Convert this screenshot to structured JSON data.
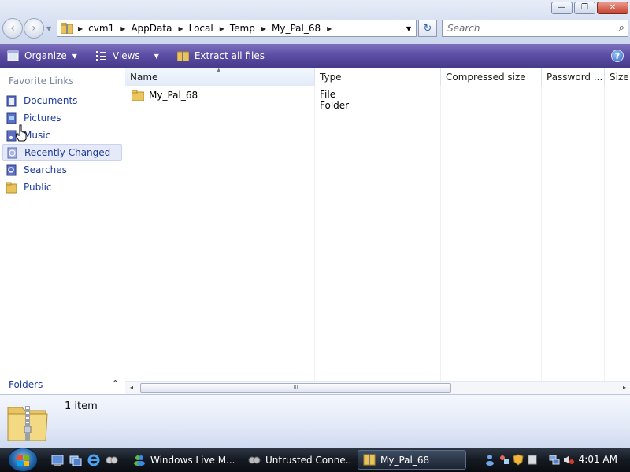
{
  "window": {
    "minimize_glyph": "—",
    "maximize_glyph": "❐",
    "close_glyph": "✕"
  },
  "address": {
    "crumbs": [
      "cvm1",
      "AppData",
      "Local",
      "Temp",
      "My_Pal_68"
    ],
    "back_glyph": "‹",
    "forward_glyph": "›",
    "dropdown_glyph": "▼",
    "refresh_glyph": "↻"
  },
  "search": {
    "placeholder": "Search",
    "icon": "search-icon"
  },
  "toolbar": {
    "organize_label": "Organize",
    "views_label": "Views",
    "extract_label": "Extract all files",
    "help_label": "?",
    "arrow": "▼"
  },
  "nav": {
    "heading": "Favorite Links",
    "items": [
      {
        "label": "Documents",
        "icon": "documents-icon"
      },
      {
        "label": "Pictures",
        "icon": "pictures-icon"
      },
      {
        "label": "Music",
        "icon": "music-icon"
      },
      {
        "label": "Recently Changed",
        "icon": "recently-changed-icon"
      },
      {
        "label": "Searches",
        "icon": "searches-icon"
      },
      {
        "label": "Public",
        "icon": "public-folder-icon"
      }
    ],
    "selected_index": 3,
    "folders_label": "Folders",
    "folders_chevron": "⌃"
  },
  "columns": [
    "Name",
    "Type",
    "Compressed size",
    "Password ...",
    "Size"
  ],
  "files": [
    {
      "name": "My_Pal_68",
      "type": "File Folder"
    }
  ],
  "scrollbar": {
    "left_glyph": "◂",
    "right_glyph": "▸",
    "grip": "III"
  },
  "details": {
    "item_count": "1 item"
  },
  "taskbar": {
    "tasks": [
      {
        "label": "Windows Live M...",
        "icon": "windows-live-messenger-icon"
      },
      {
        "label": "Untrusted Conne...",
        "icon": "untrusted-connection-icon"
      },
      {
        "label": "My_Pal_68",
        "icon": "zip-folder-icon"
      }
    ],
    "active_index": 2,
    "clock": "4:01 AM"
  },
  "colors": {
    "commandbar": "#5d4ea6",
    "link": "#1f3d9c",
    "selection": "#e6eaf8",
    "taskbar": "#151a22"
  }
}
